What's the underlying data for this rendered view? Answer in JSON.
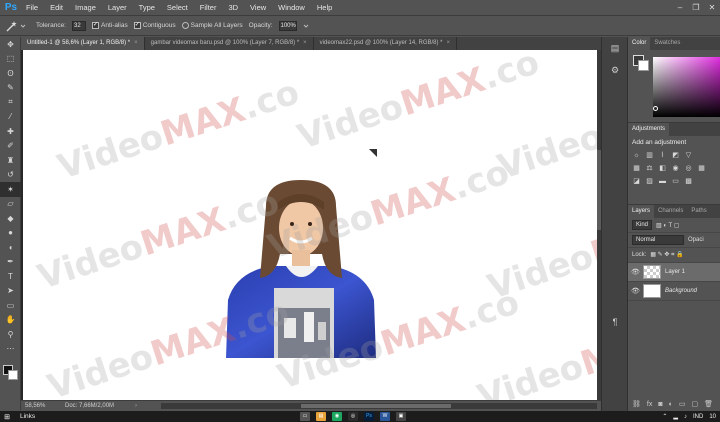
{
  "menubar": {
    "logo": "Ps",
    "items": [
      "File",
      "Edit",
      "Image",
      "Layer",
      "Type",
      "Select",
      "Filter",
      "3D",
      "View",
      "Window",
      "Help"
    ],
    "window_controls": [
      "–",
      "❐",
      "✕"
    ]
  },
  "options": {
    "tolerance_label": "Tolerance:",
    "tolerance_value": "32",
    "anti_alias_label": "Anti-alias",
    "contiguous_label": "Contiguous",
    "sample_all_label": "Sample All Layers",
    "opacity_label": "Opacity:",
    "opacity_value": "100%"
  },
  "tabs": [
    {
      "label": "Untitled-1 @ 58,6% (Layer 1, RGB/8) *",
      "close": "×"
    },
    {
      "label": "gambar videomax baru.psd @ 100% (Layer 7, RGB/8) *",
      "close": "×"
    },
    {
      "label": "videomax22.psd @ 100% (Layer 14, RGB/8) *",
      "close": "×"
    }
  ],
  "status": {
    "zoom": "58,56%",
    "doc": "Doc: 7,66M/2,00M",
    "arrow": "›"
  },
  "taskbar": {
    "links": "Links",
    "tray_lang": "IND",
    "tray_time": "10"
  },
  "panels": {
    "color_tabs": [
      "Color",
      "Swatches"
    ],
    "adjustments_tab": "Adjustments",
    "adjustments_title": "Add an adjustment",
    "layers_tabs": [
      "Layers",
      "Channels",
      "Paths"
    ],
    "kind_label": "Kind",
    "blend_mode": "Normal",
    "opacity_short": "Opaci",
    "lock_label": "Lock:",
    "layers": [
      {
        "name": "Layer 1",
        "selected": true
      },
      {
        "name": "Background",
        "selected": false
      }
    ]
  },
  "watermark": {
    "prefix": "Video",
    "brand": "MAX",
    "suffix": ".co"
  },
  "colors": {
    "accent": "#31a8ff",
    "canvas": "#ffffff",
    "panel": "#535353"
  }
}
